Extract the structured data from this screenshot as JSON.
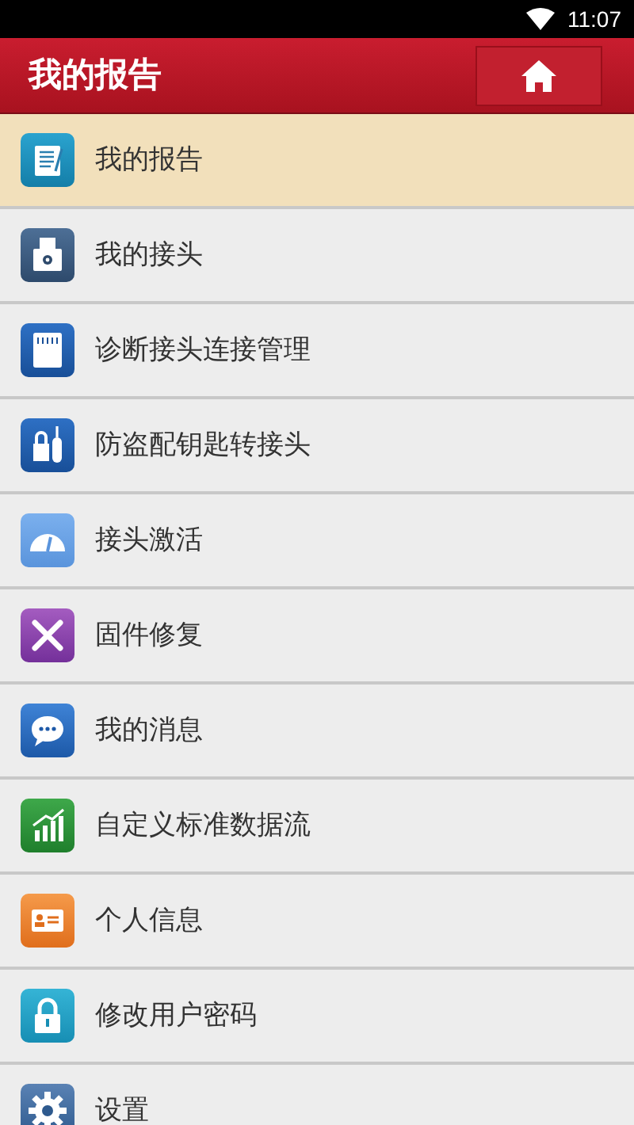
{
  "status_bar": {
    "time": "11:07"
  },
  "header": {
    "title": "我的报告"
  },
  "menu": [
    {
      "label": "我的报告",
      "selected": true
    },
    {
      "label": "我的接头",
      "selected": false
    },
    {
      "label": "诊断接头连接管理",
      "selected": false
    },
    {
      "label": "防盗配钥匙转接头",
      "selected": false
    },
    {
      "label": "接头激活",
      "selected": false
    },
    {
      "label": "固件修复",
      "selected": false
    },
    {
      "label": "我的消息",
      "selected": false
    },
    {
      "label": "自定义标准数据流",
      "selected": false
    },
    {
      "label": "个人信息",
      "selected": false
    },
    {
      "label": "修改用户密码",
      "selected": false
    },
    {
      "label": "设置",
      "selected": false
    }
  ]
}
